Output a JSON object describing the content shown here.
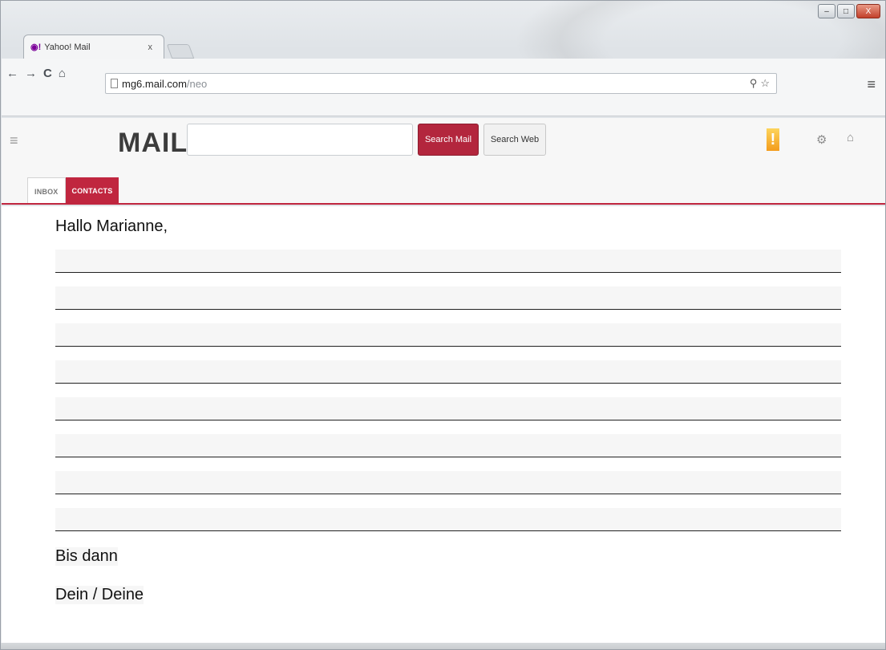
{
  "browser": {
    "tab_title": "Yahoo! Mail",
    "tab_close": "x",
    "url_host": "mg6.mail.com",
    "url_path": "/neo"
  },
  "window_controls": {
    "minimize": "–",
    "maximize": "□",
    "close": "X"
  },
  "nav": {
    "back": "←",
    "forward": "→",
    "reload": "C",
    "home": "⌂"
  },
  "mail_header": {
    "logo": "MAIL",
    "search_placeholder": "",
    "search_mail_label": "Search Mail",
    "search_web_label": "Search Web",
    "tabs": [
      {
        "label": "INBOX"
      },
      {
        "label": "CONTACTS"
      }
    ]
  },
  "message": {
    "greeting": "Hallo Marianne,",
    "line_count": 8,
    "closing_1": "Bis dann",
    "closing_2": "Dein / Deine"
  },
  "colors": {
    "accent": "#c0263f",
    "search_button": "#b3263d",
    "yahoo_bang": "#f5a623"
  },
  "icons": {
    "menu": "hamburger-icon",
    "settings": "gear-icon",
    "home": "home-icon",
    "search": "magnifier-icon",
    "bookmark": "star-icon",
    "browser_menu": "browser-menu-icon"
  }
}
